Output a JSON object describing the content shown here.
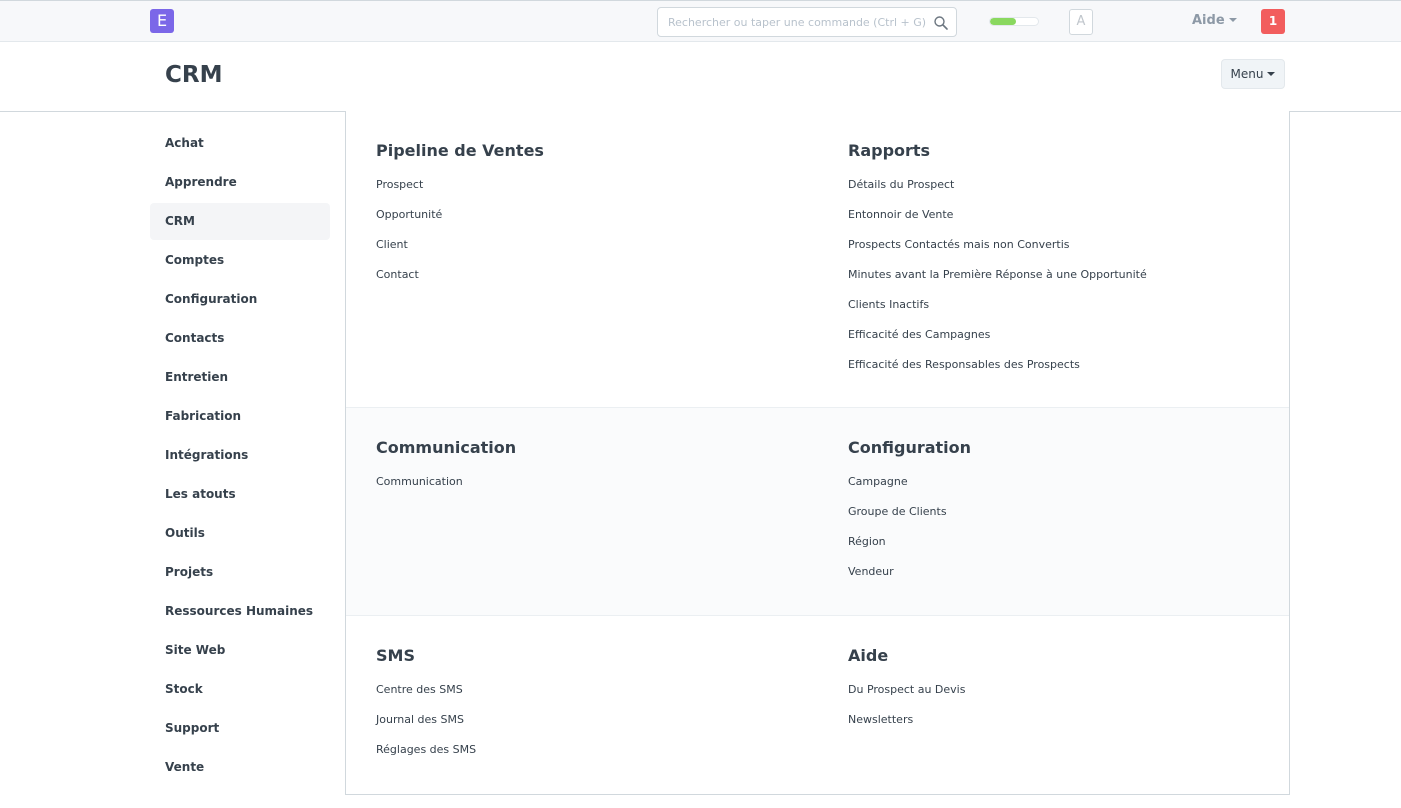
{
  "navbar": {
    "logo_letter": "E",
    "search_placeholder": "Rechercher ou taper une commande (Ctrl + G)",
    "progress_fraction": 0.55,
    "avatar_letter": "A",
    "help_label": "Aide",
    "notification_count": "1"
  },
  "page": {
    "title": "CRM",
    "menu_label": "Menu"
  },
  "sidebar": {
    "items": [
      {
        "label": "Achat"
      },
      {
        "label": "Apprendre"
      },
      {
        "label": "CRM",
        "active": true
      },
      {
        "label": "Comptes"
      },
      {
        "label": "Configuration"
      },
      {
        "label": "Contacts"
      },
      {
        "label": "Entretien"
      },
      {
        "label": "Fabrication"
      },
      {
        "label": "Intégrations"
      },
      {
        "label": "Les atouts"
      },
      {
        "label": "Outils"
      },
      {
        "label": "Projets"
      },
      {
        "label": "Ressources Humaines"
      },
      {
        "label": "Site Web"
      },
      {
        "label": "Stock"
      },
      {
        "label": "Support"
      },
      {
        "label": "Vente"
      }
    ]
  },
  "sections": [
    {
      "left": {
        "title": "Pipeline de Ventes",
        "links": [
          "Prospect",
          "Opportunité",
          "Client",
          "Contact"
        ]
      },
      "right": {
        "title": "Rapports",
        "links": [
          "Détails du Prospect",
          "Entonnoir de Vente",
          "Prospects Contactés mais non Convertis",
          "Minutes avant la Première Réponse à une Opportunité",
          "Clients Inactifs",
          "Efficacité des Campagnes",
          "Efficacité des Responsables des Prospects"
        ]
      }
    },
    {
      "left": {
        "title": "Communication",
        "links": [
          "Communication"
        ]
      },
      "right": {
        "title": "Configuration",
        "links": [
          "Campagne",
          "Groupe de Clients",
          "Région",
          "Vendeur"
        ]
      }
    },
    {
      "left": {
        "title": "SMS",
        "links": [
          "Centre des SMS",
          "Journal des SMS",
          "Réglages des SMS"
        ]
      },
      "right": {
        "title": "Aide",
        "links": [
          "Du Prospect au Devis",
          "Newsletters"
        ]
      }
    }
  ],
  "colors": {
    "logo": "#7b67e8",
    "notification": "#f25d5d",
    "progress": "#8ad85f"
  }
}
